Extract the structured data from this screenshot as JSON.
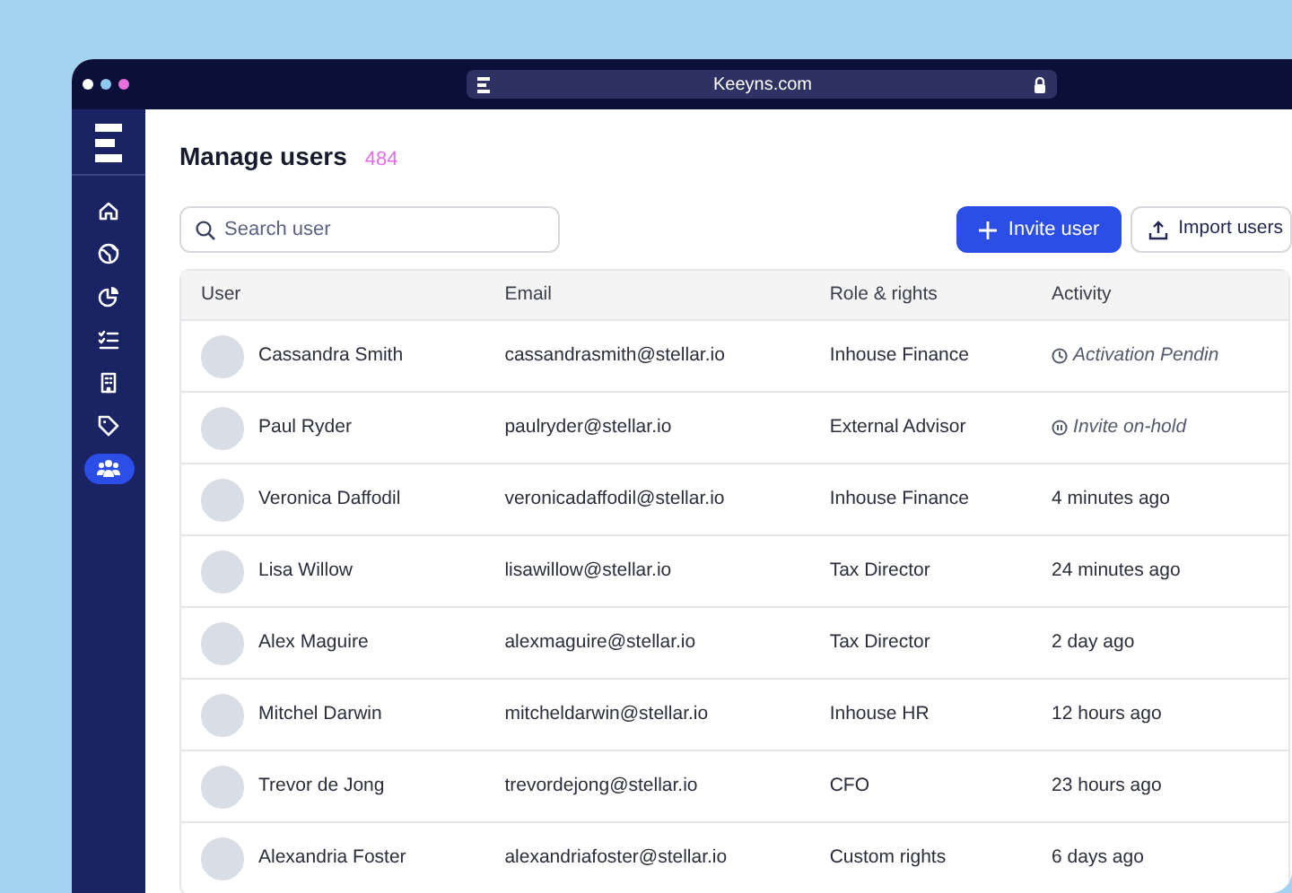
{
  "browser": {
    "address": "Keeyns.com"
  },
  "sidebar": {
    "items": [
      {
        "kind": "home",
        "selected": false
      },
      {
        "kind": "globe",
        "selected": false
      },
      {
        "kind": "chart",
        "selected": false
      },
      {
        "kind": "checklist",
        "selected": false
      },
      {
        "kind": "building",
        "selected": false
      },
      {
        "kind": "tag",
        "selected": false
      },
      {
        "kind": "users",
        "selected": true
      }
    ]
  },
  "header": {
    "title": "Manage users",
    "count": "484"
  },
  "search": {
    "placeholder": "Search user"
  },
  "buttons": [
    {
      "kind": "primary",
      "label": "Invite user"
    },
    {
      "kind": "secondary",
      "label": "Import users"
    }
  ],
  "table": {
    "columns": [
      "User",
      "Email",
      "Role & rights",
      "Activity"
    ],
    "rows": [
      {
        "user": "Cassandra Smith",
        "email": "cassandrasmith@stellar.io",
        "role": "Inhouse Finance",
        "activity": {
          "kind": "pending",
          "text": "Activation Pendin"
        }
      },
      {
        "user": "Paul Ryder",
        "email": "paulryder@stellar.io",
        "role": "External Advisor",
        "activity": {
          "kind": "on-hold",
          "text": "Invite on-hold"
        }
      },
      {
        "user": "Veronica Daffodil",
        "email": "veronicadaffodil@stellar.io",
        "role": "Inhouse Finance",
        "activity": {
          "kind": "time",
          "text": "4 minutes ago"
        }
      },
      {
        "user": "Lisa Willow",
        "email": "lisawillow@stellar.io",
        "role": "Tax Director",
        "activity": {
          "kind": "time",
          "text": "24 minutes ago"
        }
      },
      {
        "user": "Alex Maguire",
        "email": "alexmaguire@stellar.io",
        "role": "Tax Director",
        "activity": {
          "kind": "time",
          "text": "2 day ago"
        }
      },
      {
        "user": "Mitchel Darwin",
        "email": "mitcheldarwin@stellar.io",
        "role": "Inhouse HR",
        "activity": {
          "kind": "time",
          "text": "12 hours ago"
        }
      },
      {
        "user": "Trevor de Jong",
        "email": "trevordejong@stellar.io",
        "role": "CFO",
        "activity": {
          "kind": "time",
          "text": "23 hours ago"
        }
      },
      {
        "user": "Alexandria Foster",
        "email": "alexandriafoster@stellar.io",
        "role": "Custom rights",
        "activity": {
          "kind": "time",
          "text": "6 days ago"
        }
      }
    ]
  }
}
